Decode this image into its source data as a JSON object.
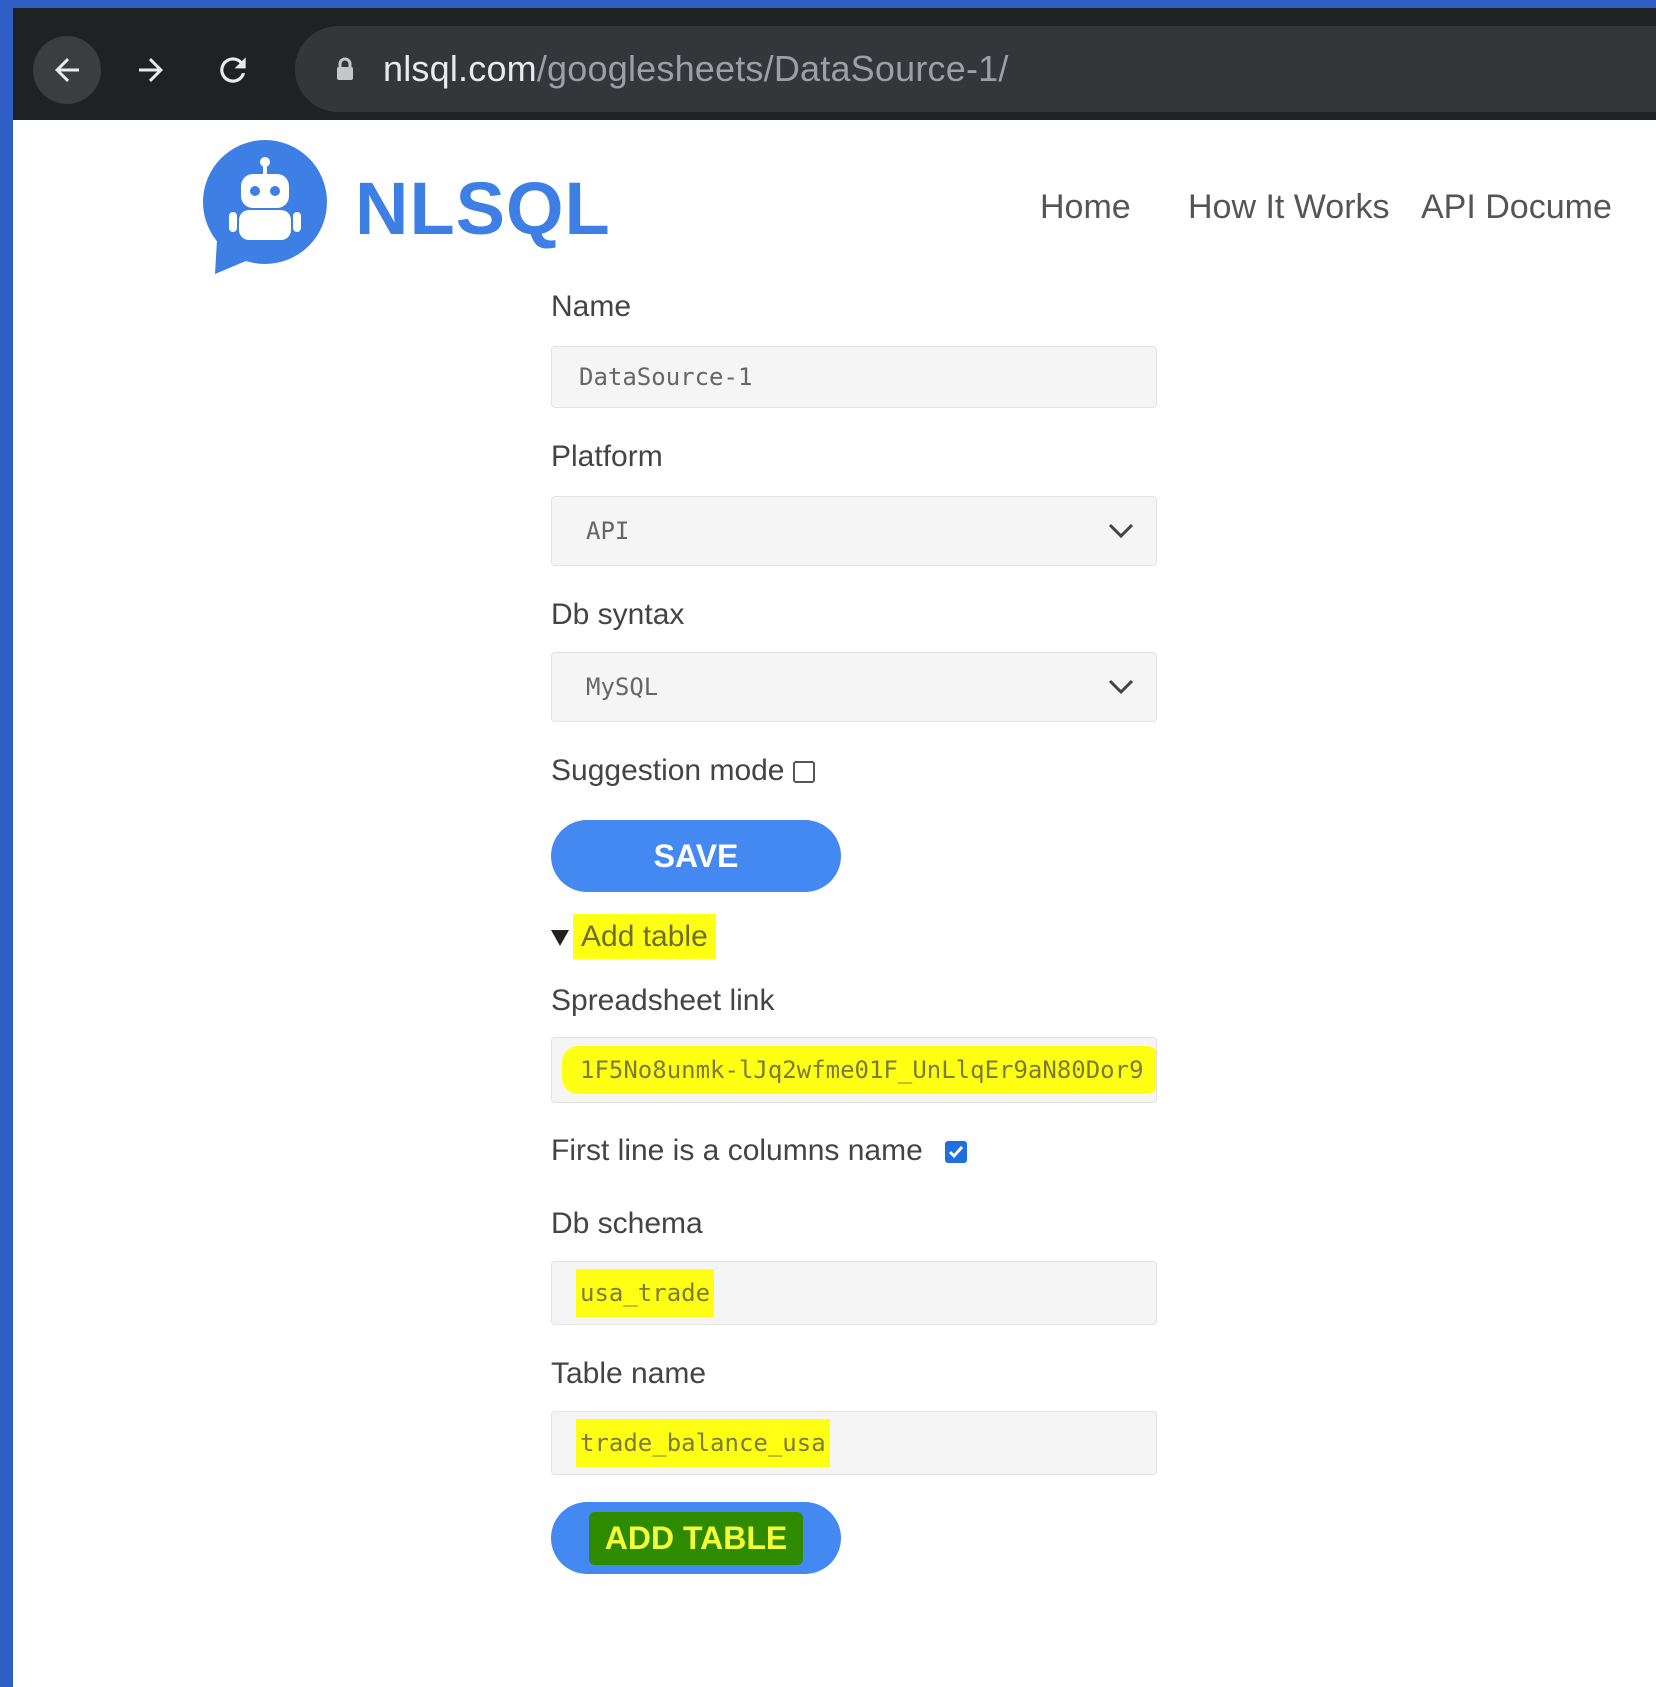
{
  "browser": {
    "url_host": "nlsql.com",
    "url_path": "/googlesheets/DataSource-1/"
  },
  "site": {
    "brand": "NLSQL",
    "nav": [
      "Home",
      "How It Works",
      "API Docume"
    ]
  },
  "form": {
    "name_label": "Name",
    "name_value": "DataSource-1",
    "platform_label": "Platform",
    "platform_value": "API",
    "db_syntax_label": "Db syntax",
    "db_syntax_value": "MySQL",
    "suggestion_label": "Suggestion mode",
    "suggestion_checked": false,
    "save_label": "SAVE"
  },
  "add_table": {
    "summary": "Add table",
    "spreadsheet_label": "Spreadsheet link",
    "spreadsheet_value": "1F5No8unmk-lJq2wfme01F_UnLlqEr9aN80Dor9",
    "first_line_label": "First line is a columns name",
    "first_line_checked": true,
    "schema_label": "Db schema",
    "schema_value": "usa_trade",
    "table_label": "Table name",
    "table_value": "trade_balance_usa",
    "add_label": "ADD TABLE"
  },
  "colors": {
    "accent": "#4488f2",
    "highlight": "#ffff14",
    "highlight_dark": "#2e8b00"
  }
}
